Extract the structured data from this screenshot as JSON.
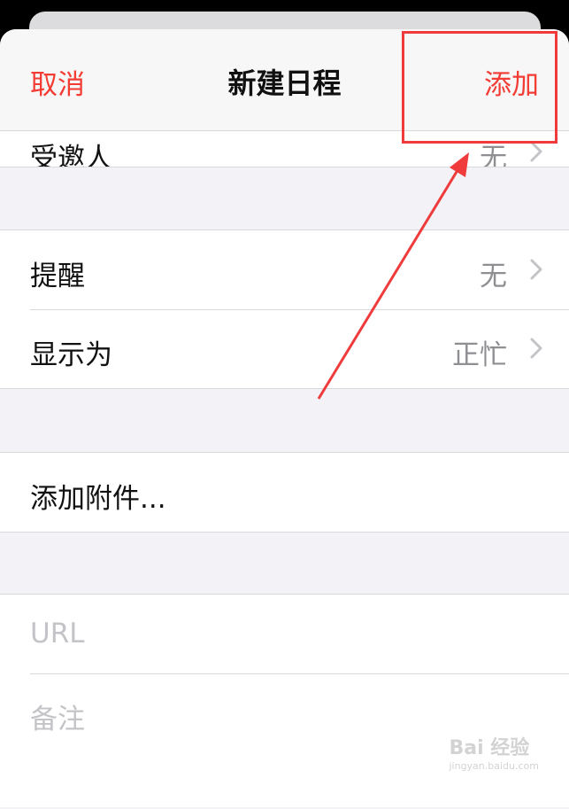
{
  "nav": {
    "cancel_label": "取消",
    "title": "新建日程",
    "add_label": "添加"
  },
  "partial_row": {
    "label": "受邀人",
    "value": "无"
  },
  "alerts_group": {
    "rows": [
      {
        "label": "提醒",
        "value": "无"
      },
      {
        "label": "显示为",
        "value": "正忙"
      }
    ]
  },
  "attachment": {
    "label": "添加附件..."
  },
  "notes_group": {
    "url_placeholder": "URL",
    "notes_placeholder": "备注"
  },
  "annotation": {
    "color": "#ef3b3b"
  },
  "colors": {
    "accent": "#f23c34",
    "secondary_text": "#8e8e93",
    "placeholder": "#c4c4c8",
    "background": "#f2f2f7"
  },
  "watermark": {
    "text": "Bai 经验",
    "sub": "jingyan.baidu.com"
  }
}
